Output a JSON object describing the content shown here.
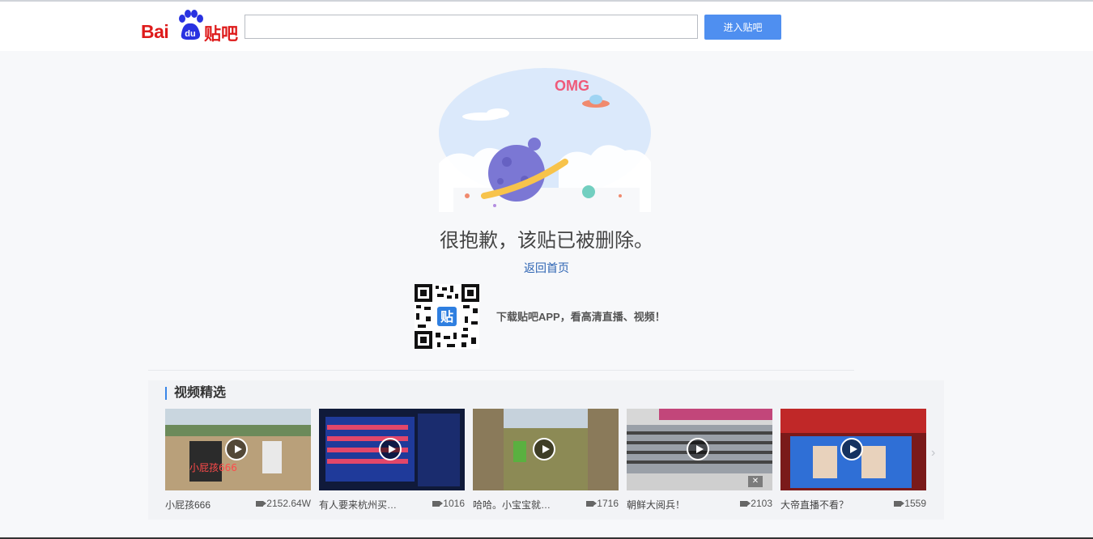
{
  "header": {
    "logo_bai": "Bai",
    "logo_du": "du",
    "logo_tieba": "贴吧",
    "search": {
      "value": "",
      "placeholder": ""
    },
    "enter_button": "进入贴吧"
  },
  "illustration": {
    "omg_text": "OMG",
    "icon": "planet-illustration"
  },
  "main": {
    "message": "很抱歉，该贴已被删除。",
    "home_link": "返回首页",
    "qr_badge": "贴",
    "app_promo": "下载贴吧APP，看高清直播、视频！"
  },
  "videos": {
    "title": "视频精选",
    "items": [
      {
        "title": "小屁孩666",
        "count": "2152.64W",
        "overlay": "小屁孩666"
      },
      {
        "title": "有人要来杭州买…",
        "count": "1016"
      },
      {
        "title": "哈哈。小宝宝就…",
        "count": "1716"
      },
      {
        "title": "朝鲜大阅兵！",
        "count": "2103"
      },
      {
        "title": "大帝直播不看？",
        "count": "1559"
      }
    ],
    "next_arrow": "›"
  },
  "colors": {
    "brand_red": "#de1b1b",
    "brand_blue": "#2932e1",
    "button_blue": "#4f8ff0",
    "link_blue": "#2d64b3"
  }
}
